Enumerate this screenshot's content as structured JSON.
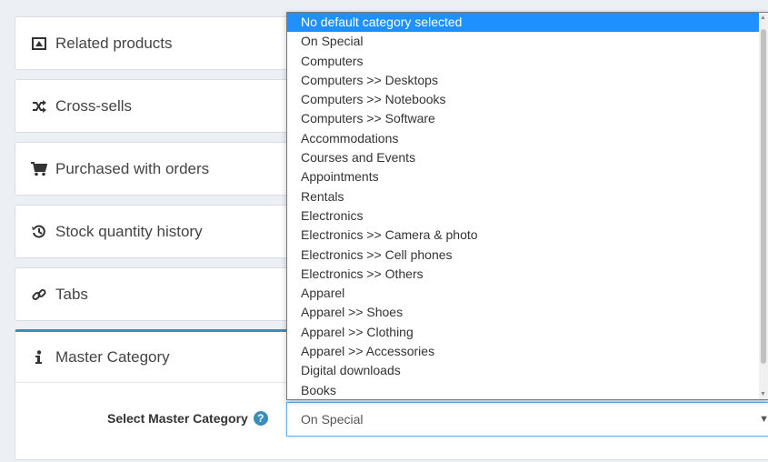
{
  "panels": {
    "related_products": "Related products",
    "cross_sells": "Cross-sells",
    "purchased_with_orders": "Purchased with orders",
    "stock_quantity_history": "Stock quantity history",
    "tabs": "Tabs",
    "master_category": "Master Category"
  },
  "master": {
    "field_label": "Select Master Category",
    "selected_value": "On Special",
    "help_icon": "?"
  },
  "dropdown": {
    "options": [
      "No default category selected",
      "On Special",
      "Computers",
      "Computers >> Desktops",
      "Computers >> Notebooks",
      "Computers >> Software",
      "Accommodations",
      "Courses and Events",
      "Appointments",
      "Rentals",
      "Electronics",
      "Electronics >> Camera & photo",
      "Electronics >> Cell phones",
      "Electronics >> Others",
      "Apparel",
      "Apparel >> Shoes",
      "Apparel >> Clothing",
      "Apparel >> Accessories",
      "Digital downloads",
      "Books"
    ],
    "highlighted_index": 0
  },
  "icons": {
    "related": "related-products-icon",
    "cross": "shuffle-icon",
    "purchased": "cart-icon",
    "stock": "history-icon",
    "tabs": "link-icon",
    "master": "info-icon"
  },
  "colors": {
    "accent": "#3c8dbc",
    "highlight": "#1e90ff"
  }
}
